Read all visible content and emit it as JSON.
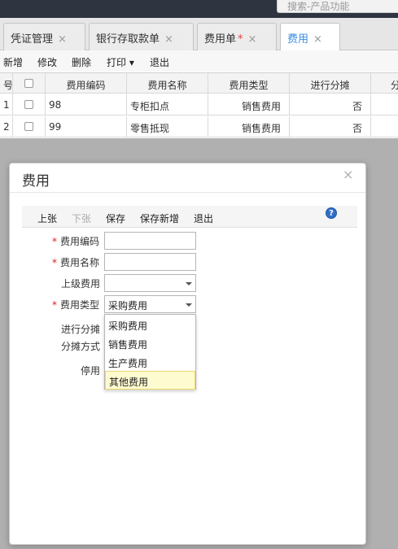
{
  "search": {
    "placeholder": "搜索-产品功能"
  },
  "tabs": [
    {
      "label": "凭证管理",
      "close": "×"
    },
    {
      "label": "银行存取款单",
      "close": "×"
    },
    {
      "label": "费用单",
      "star": "*",
      "close": "×"
    },
    {
      "label": "费用",
      "close": "×",
      "active": true
    }
  ],
  "toolbar": {
    "add": "新增",
    "edit": "修改",
    "delete": "删除",
    "print": "打印",
    "print_arrow": "▾",
    "exit": "退出"
  },
  "grid": {
    "columns": [
      "号",
      "",
      "费用编码",
      "费用名称",
      "费用类型",
      "进行分摊",
      "分"
    ],
    "rows": [
      {
        "num": "1",
        "code": "98",
        "name": "专柜扣点",
        "type": "销售费用",
        "allocate": "否"
      },
      {
        "num": "2",
        "code": "99",
        "name": "零售抵现",
        "type": "销售费用",
        "allocate": "否"
      }
    ]
  },
  "dialog": {
    "title": "费用",
    "close": "×",
    "toolbar": {
      "prev": "上张",
      "next": "下张",
      "save": "保存",
      "save_new": "保存新增",
      "exit": "退出",
      "help": "?"
    },
    "form": {
      "required_mark": "*",
      "code_label": "费用编码",
      "code_value": "",
      "name_label": "费用名称",
      "name_value": "",
      "parent_label": "上级费用",
      "parent_value": "",
      "type_label": "费用类型",
      "type_value": "采购费用",
      "allocate_label": "进行分摊",
      "method_label": "分摊方式",
      "disable_label": "停用"
    },
    "type_options": [
      "采购费用",
      "销售费用",
      "生产费用",
      "其他费用"
    ],
    "highlighted_option": "其他费用"
  }
}
